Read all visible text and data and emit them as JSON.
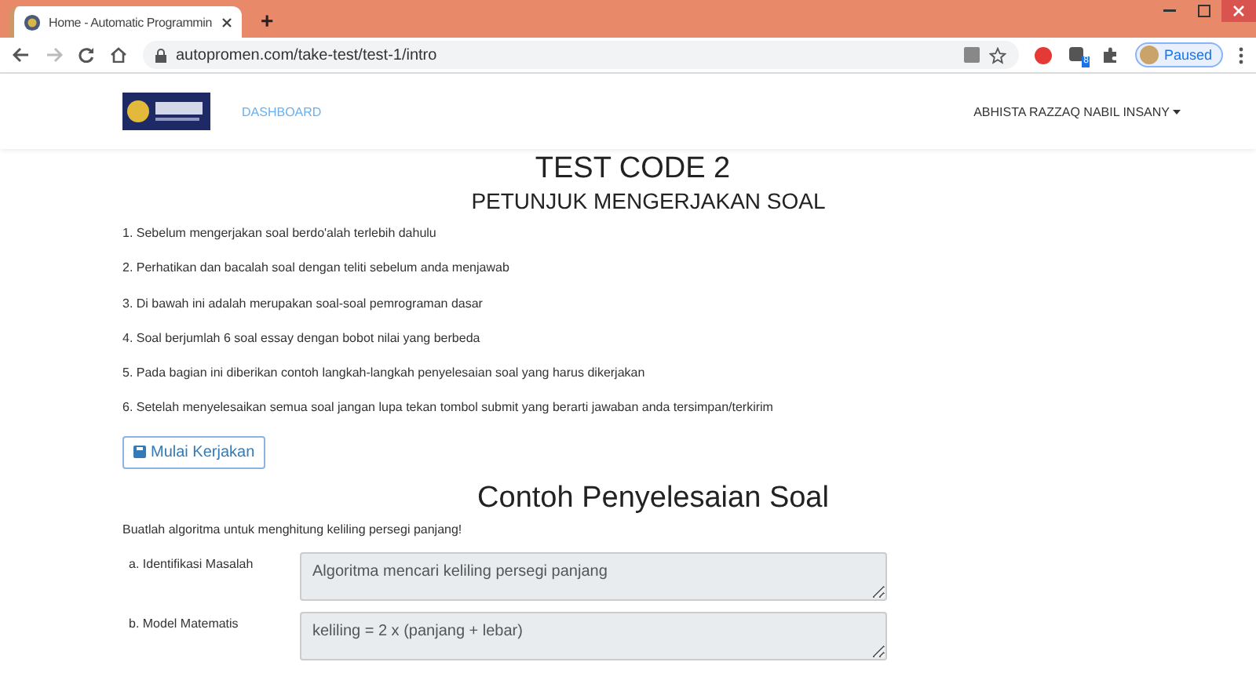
{
  "browser": {
    "tab_title": "Home - Automatic Programmin",
    "new_tab": "+",
    "url": "autopromen.com/take-test/test-1/intro",
    "profile_status": "Paused",
    "extension_badge": "8"
  },
  "navbar": {
    "nav_link": "DASHBOARD",
    "user_menu": "ABHISTA RAZZAQ NABIL INSANY"
  },
  "page": {
    "title": "TEST CODE 2",
    "subtitle": "PETUNJUK MENGERJAKAN SOAL",
    "instructions": [
      "1. Sebelum mengerjakan soal berdo'alah terlebih dahulu",
      "2. Perhatikan dan bacalah soal dengan teliti sebelum anda menjawab",
      "3. Di bawah ini adalah merupakan soal-soal pemrograman dasar",
      "4. Soal berjumlah 6 soal essay dengan bobot nilai yang berbeda",
      "5. Pada bagian ini diberikan contoh langkah-langkah penyelesaian soal yang harus dikerjakan",
      "6. Setelah menyelesaikan semua soal jangan lupa tekan tombol submit yang berarti jawaban anda tersimpan/terkirim"
    ],
    "start_button": "Mulai Kerjakan",
    "example_heading": "Contoh Penyelesaian Soal",
    "question": "Buatlah algoritma untuk menghitung keliling persegi panjang!",
    "steps": [
      {
        "label": "a. Identifikasi Masalah",
        "value": "Algoritma mencari keliling persegi panjang"
      },
      {
        "label": "b. Model Matematis",
        "value": "keliling = 2 x (panjang + lebar)"
      }
    ]
  }
}
